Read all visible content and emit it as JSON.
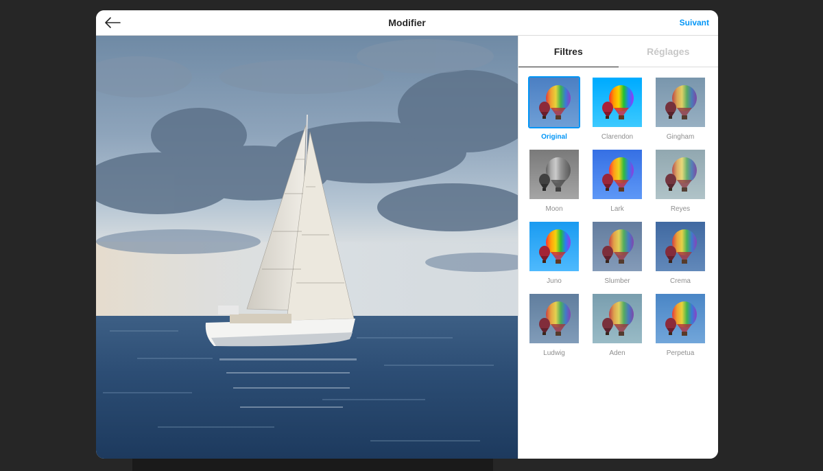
{
  "header": {
    "title": "Modifier",
    "next_label": "Suivant"
  },
  "colors": {
    "accent": "#0095f6",
    "modal_bg": "#ffffff",
    "page_bg": "#262626"
  },
  "icons": {
    "back": "arrow-left-icon"
  },
  "panel": {
    "tabs": [
      {
        "label": "Filtres",
        "active": true
      },
      {
        "label": "Réglages",
        "active": false
      }
    ],
    "filters": [
      {
        "label": "Original",
        "selected": true
      },
      {
        "label": "Clarendon",
        "selected": false
      },
      {
        "label": "Gingham",
        "selected": false
      },
      {
        "label": "Moon",
        "selected": false
      },
      {
        "label": "Lark",
        "selected": false
      },
      {
        "label": "Reyes",
        "selected": false
      },
      {
        "label": "Juno",
        "selected": false
      },
      {
        "label": "Slumber",
        "selected": false
      },
      {
        "label": "Crema",
        "selected": false
      },
      {
        "label": "Ludwig",
        "selected": false
      },
      {
        "label": "Aden",
        "selected": false
      },
      {
        "label": "Perpetua",
        "selected": false
      }
    ]
  }
}
